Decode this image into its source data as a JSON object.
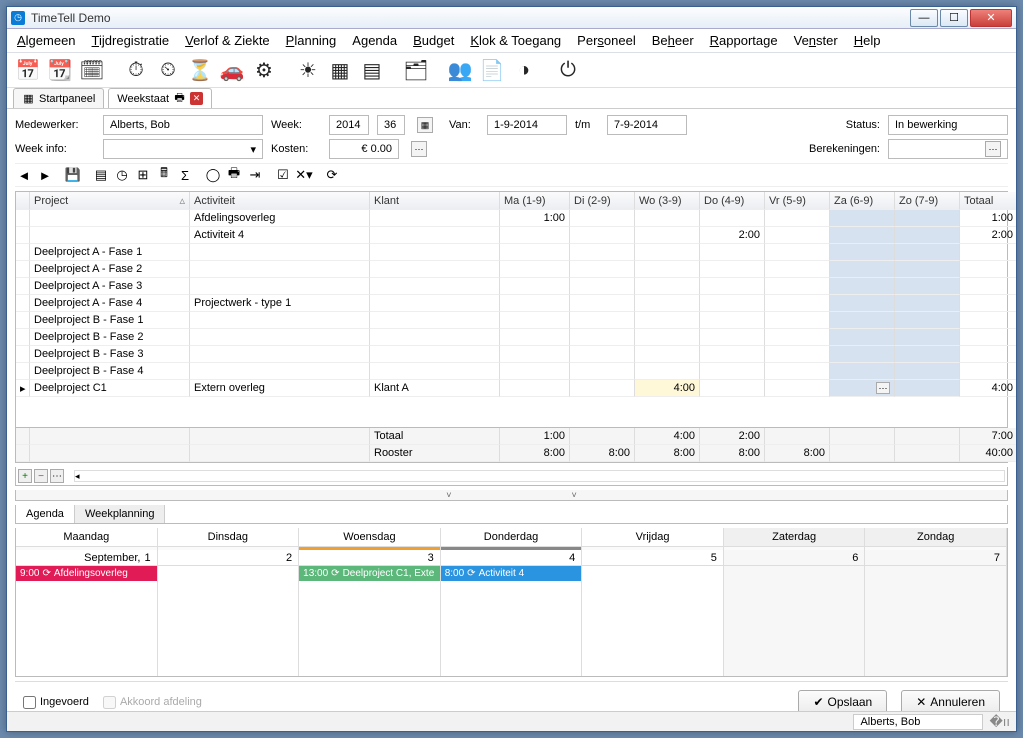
{
  "window": {
    "title": "TimeTell Demo"
  },
  "menu": [
    "<u>A</u>lgemeen",
    "<u>T</u>ijdregistratie",
    "<u>V</u>erlof & Ziekte",
    "<u>P</u>lanning",
    "A<u>g</u>enda",
    "<u>B</u>udget",
    "<u>K</u>lok & Toegang",
    "Per<u>s</u>oneel",
    "Be<u>h</u>eer",
    "<u>R</u>apportage",
    "Ve<u>n</u>ster",
    "<u>H</u>elp"
  ],
  "tabs": {
    "start": "Startpaneel",
    "week": "Weekstaat"
  },
  "form": {
    "medewerker_label": "Medewerker:",
    "medewerker_value": "Alberts, Bob",
    "week_label": "Week:",
    "year": "2014",
    "weeknum": "36",
    "van_label": "Van:",
    "van_value": "1-9-2014",
    "tm_label": "t/m",
    "tm_value": "7-9-2014",
    "status_label": "Status:",
    "status_value": "In bewerking",
    "weekinfo_label": "Week info:",
    "kosten_label": "Kosten:",
    "kosten_value": "€ 0.00",
    "berek_label": "Berekeningen:"
  },
  "grid": {
    "headers": [
      "",
      "Project",
      "Activiteit",
      "Klant",
      "Ma (1-9)",
      "Di (2-9)",
      "Wo (3-9)",
      "Do (4-9)",
      "Vr (5-9)",
      "Za (6-9)",
      "Zo (7-9)",
      "Totaal"
    ],
    "rows": [
      {
        "ptr": "",
        "project": "",
        "act": "Afdelingsoverleg",
        "klant": "",
        "ma": "1:00",
        "di": "",
        "wo": "",
        "do": "",
        "vr": "",
        "za": "",
        "zo": "",
        "tot": "1:00"
      },
      {
        "ptr": "",
        "project": "",
        "act": "Activiteit 4",
        "klant": "",
        "ma": "",
        "di": "",
        "wo": "",
        "do": "2:00",
        "vr": "",
        "za": "",
        "zo": "",
        "tot": "2:00"
      },
      {
        "ptr": "",
        "project": "Deelproject A - Fase 1",
        "act": "",
        "klant": "",
        "ma": "",
        "di": "",
        "wo": "",
        "do": "",
        "vr": "",
        "za": "",
        "zo": "",
        "tot": ""
      },
      {
        "ptr": "",
        "project": "Deelproject A - Fase 2",
        "act": "",
        "klant": "",
        "ma": "",
        "di": "",
        "wo": "",
        "do": "",
        "vr": "",
        "za": "",
        "zo": "",
        "tot": ""
      },
      {
        "ptr": "",
        "project": "Deelproject A - Fase 3",
        "act": "",
        "klant": "",
        "ma": "",
        "di": "",
        "wo": "",
        "do": "",
        "vr": "",
        "za": "",
        "zo": "",
        "tot": ""
      },
      {
        "ptr": "",
        "project": "Deelproject A - Fase 4",
        "act": "Projectwerk - type 1",
        "klant": "",
        "ma": "",
        "di": "",
        "wo": "",
        "do": "",
        "vr": "",
        "za": "",
        "zo": "",
        "tot": ""
      },
      {
        "ptr": "",
        "project": "Deelproject B - Fase 1",
        "act": "",
        "klant": "",
        "ma": "",
        "di": "",
        "wo": "",
        "do": "",
        "vr": "",
        "za": "",
        "zo": "",
        "tot": ""
      },
      {
        "ptr": "",
        "project": "Deelproject B - Fase 2",
        "act": "",
        "klant": "",
        "ma": "",
        "di": "",
        "wo": "",
        "do": "",
        "vr": "",
        "za": "",
        "zo": "",
        "tot": ""
      },
      {
        "ptr": "",
        "project": "Deelproject B - Fase 3",
        "act": "",
        "klant": "",
        "ma": "",
        "di": "",
        "wo": "",
        "do": "",
        "vr": "",
        "za": "",
        "zo": "",
        "tot": ""
      },
      {
        "ptr": "",
        "project": "Deelproject B - Fase 4",
        "act": "",
        "klant": "",
        "ma": "",
        "di": "",
        "wo": "",
        "do": "",
        "vr": "",
        "za": "",
        "zo": "",
        "tot": ""
      },
      {
        "ptr": "▸",
        "project": "Deelproject C1",
        "act": "Extern overleg",
        "klant": "Klant A",
        "ma": "",
        "di": "",
        "wo": "4:00",
        "do": "",
        "vr": "",
        "za": "…",
        "zo": "",
        "tot": "4:00",
        "editing": true
      }
    ],
    "totals": {
      "label": "Totaal",
      "ma": "1:00",
      "di": "",
      "wo": "4:00",
      "do": "2:00",
      "vr": "",
      "za": "",
      "zo": "",
      "tot": "7:00"
    },
    "rooster": {
      "label": "Rooster",
      "ma": "8:00",
      "di": "8:00",
      "wo": "8:00",
      "do": "8:00",
      "vr": "8:00",
      "za": "",
      "zo": "",
      "tot": "40:00"
    }
  },
  "bottom_tabs": {
    "agenda": "Agenda",
    "weekplanning": "Weekplanning"
  },
  "cal": {
    "days": [
      "Maandag",
      "Dinsdag",
      "Woensdag",
      "Donderdag",
      "Vrijdag",
      "Zaterdag",
      "Zondag"
    ],
    "month_label": "September,",
    "dates": [
      "1",
      "2",
      "3",
      "4",
      "5",
      "6",
      "7"
    ],
    "events": {
      "mon": {
        "time": "9:00",
        "text": "Afdelingsoverleg",
        "cls": "ev-red"
      },
      "wed": {
        "time": "13:00",
        "text": "Deelproject C1, Exte",
        "cls": "ev-green"
      },
      "thu": {
        "time": "8:00",
        "text": "Activiteit 4",
        "cls": "ev-blue"
      }
    }
  },
  "footer": {
    "ingevoerd": "Ingevoerd",
    "akkoord": "Akkoord afdeling",
    "opslaan": "Opslaan",
    "annuleren": "Annuleren"
  },
  "status_bar": {
    "user": "Alberts, Bob"
  }
}
